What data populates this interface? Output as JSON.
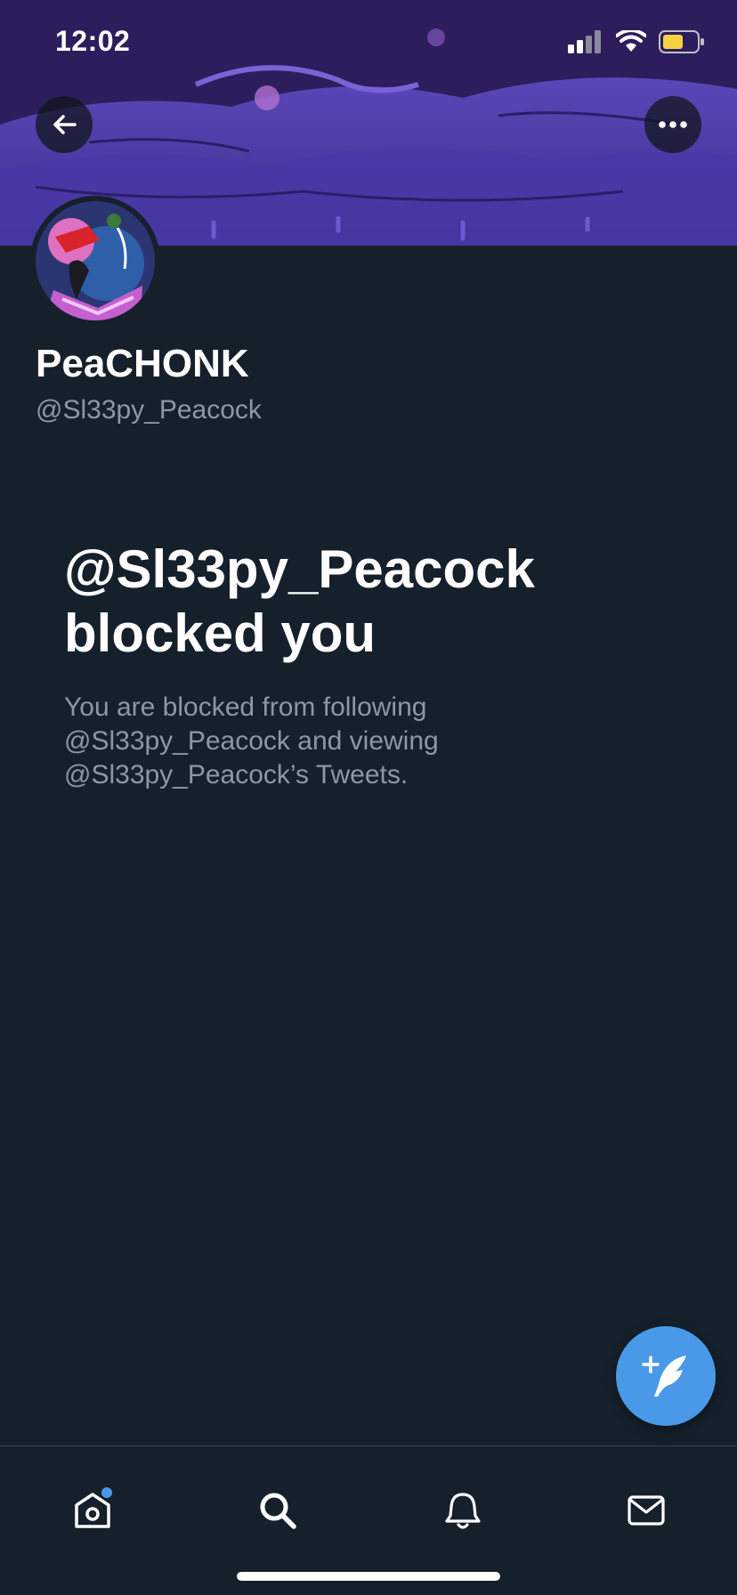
{
  "status_bar": {
    "time": "12:02",
    "battery_color": "#f5d142"
  },
  "header": {
    "back_icon": "arrow-left-icon",
    "more_icon": "more-horizontal-icon"
  },
  "profile": {
    "display_name": "PeaCHONK",
    "handle": "@Sl33py_Peacock"
  },
  "blocked": {
    "title_line1": "@Sl33py_Peacock",
    "title_line2": "blocked you",
    "description_line1": "You are blocked from following",
    "description_line2": "@Sl33py_Peacock and viewing",
    "description_line3": "@Sl33py_Peacock’s Tweets."
  },
  "fab": {
    "icon": "compose-tweet-icon",
    "color": "#4a99e9"
  },
  "bottom_nav": {
    "items": [
      {
        "icon": "home-icon",
        "has_badge": true
      },
      {
        "icon": "search-icon",
        "active": true
      },
      {
        "icon": "bell-icon"
      },
      {
        "icon": "mail-icon"
      }
    ]
  },
  "colors": {
    "background": "#15202b",
    "text_primary": "#ffffff",
    "text_secondary": "#8b98a5",
    "accent": "#4a99e9",
    "divider": "#38444d"
  }
}
